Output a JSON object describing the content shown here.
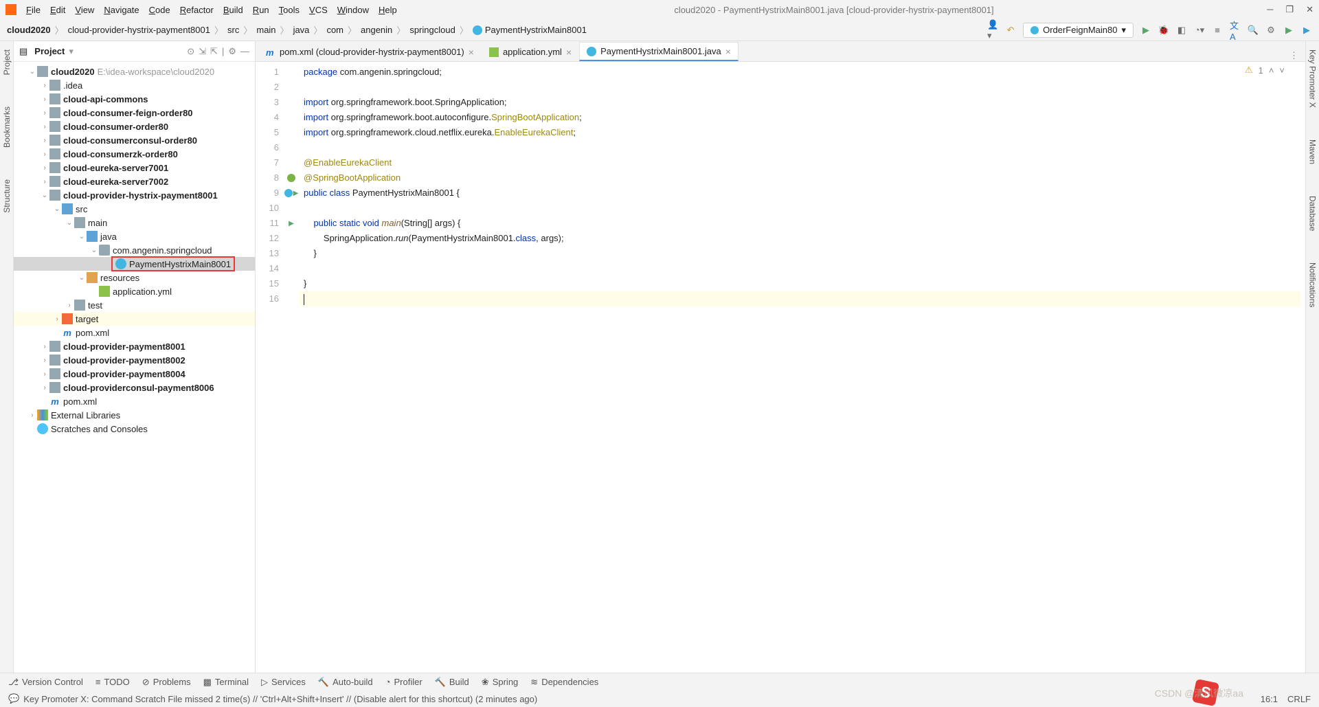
{
  "title_bar": {
    "menus": [
      "File",
      "Edit",
      "View",
      "Navigate",
      "Code",
      "Refactor",
      "Build",
      "Run",
      "Tools",
      "VCS",
      "Window",
      "Help"
    ],
    "window_title": "cloud2020 - PaymentHystrixMain8001.java [cloud-provider-hystrix-payment8001]"
  },
  "breadcrumb": [
    "cloud2020",
    "cloud-provider-hystrix-payment8001",
    "src",
    "main",
    "java",
    "com",
    "angenin",
    "springcloud",
    "PaymentHystrixMain8001"
  ],
  "run_config": "OrderFeignMain80",
  "panel": {
    "title": "Project"
  },
  "tree": {
    "root": {
      "label": "cloud2020",
      "hint": "E:\\idea-workspace\\cloud2020"
    },
    "nodes": [
      {
        "l": ".idea",
        "d": 0,
        "t": "folder",
        "a": ">"
      },
      {
        "l": "cloud-api-commons",
        "d": 0,
        "t": "folder",
        "a": ">",
        "b": true
      },
      {
        "l": "cloud-consumer-feign-order80",
        "d": 0,
        "t": "folder",
        "a": ">",
        "b": true
      },
      {
        "l": "cloud-consumer-order80",
        "d": 0,
        "t": "folder",
        "a": ">",
        "b": true
      },
      {
        "l": "cloud-consumerconsul-order80",
        "d": 0,
        "t": "folder",
        "a": ">",
        "b": true
      },
      {
        "l": "cloud-consumerzk-order80",
        "d": 0,
        "t": "folder",
        "a": ">",
        "b": true
      },
      {
        "l": "cloud-eureka-server7001",
        "d": 0,
        "t": "folder",
        "a": ">",
        "b": true
      },
      {
        "l": "cloud-eureka-server7002",
        "d": 0,
        "t": "folder",
        "a": ">",
        "b": true
      },
      {
        "l": "cloud-provider-hystrix-payment8001",
        "d": 0,
        "t": "folder",
        "a": "v",
        "b": true
      },
      {
        "l": "src",
        "d": 1,
        "t": "folder src",
        "a": "v"
      },
      {
        "l": "main",
        "d": 2,
        "t": "folder",
        "a": "v"
      },
      {
        "l": "java",
        "d": 3,
        "t": "folder src",
        "a": "v"
      },
      {
        "l": "com.angenin.springcloud",
        "d": 4,
        "t": "pkg",
        "a": "v"
      },
      {
        "l": "PaymentHystrixMain8001",
        "d": 5,
        "t": "class",
        "a": "",
        "selected": true,
        "redbox": true
      },
      {
        "l": "resources",
        "d": 3,
        "t": "folder res",
        "a": "v"
      },
      {
        "l": "application.yml",
        "d": 4,
        "t": "yml",
        "a": ""
      },
      {
        "l": "test",
        "d": 2,
        "t": "folder",
        "a": ">"
      },
      {
        "l": "target",
        "d": 1,
        "t": "folder target",
        "a": ">",
        "hl": true
      },
      {
        "l": "pom.xml",
        "d": 1,
        "t": "pom",
        "a": ""
      },
      {
        "l": "cloud-provider-payment8001",
        "d": 0,
        "t": "folder",
        "a": ">",
        "b": true
      },
      {
        "l": "cloud-provider-payment8002",
        "d": 0,
        "t": "folder",
        "a": ">",
        "b": true
      },
      {
        "l": "cloud-provider-payment8004",
        "d": 0,
        "t": "folder",
        "a": ">",
        "b": true
      },
      {
        "l": "cloud-providerconsul-payment8006",
        "d": 0,
        "t": "folder",
        "a": ">",
        "b": true
      },
      {
        "l": "pom.xml",
        "d": 0,
        "t": "pom",
        "a": ""
      }
    ],
    "extras": [
      {
        "l": "External Libraries",
        "t": "lib",
        "a": ">"
      },
      {
        "l": "Scratches and Consoles",
        "t": "scratch",
        "a": ""
      }
    ]
  },
  "tabs": [
    {
      "label": "pom.xml (cloud-provider-hystrix-payment8001)",
      "icon": "pom",
      "active": false
    },
    {
      "label": "application.yml",
      "icon": "yml",
      "active": false
    },
    {
      "label": "PaymentHystrixMain8001.java",
      "icon": "class",
      "active": true
    }
  ],
  "editor": {
    "warn_count": "1",
    "lines": [
      {
        "n": 1,
        "html": "<span class='k'>package</span> com.angenin.springcloud;"
      },
      {
        "n": 2,
        "html": ""
      },
      {
        "n": 3,
        "html": "<span class='k'>import</span> org.springframework.boot.SpringApplication;"
      },
      {
        "n": 4,
        "html": "<span class='k'>import</span> org.springframework.boot.autoconfigure.<span class='ann'>SpringBootApplication</span>;"
      },
      {
        "n": 5,
        "html": "<span class='k'>import</span> org.springframework.cloud.netflix.eureka.<span class='ann'>EnableEurekaClient</span>;"
      },
      {
        "n": 6,
        "html": ""
      },
      {
        "n": 7,
        "html": "<span class='ann'>@EnableEurekaClient</span>"
      },
      {
        "n": 8,
        "html": "<span class='ann'>@SpringBootApplication</span>",
        "g": "circ"
      },
      {
        "n": 9,
        "html": "<span class='k'>public</span> <span class='k'>class</span> PaymentHystrixMain8001 {",
        "g": "run2"
      },
      {
        "n": 10,
        "html": ""
      },
      {
        "n": 11,
        "html": "    <span class='k'>public</span> <span class='k'>static</span> <span class='k'>void</span> <span class='mth'>main</span>(String[] args) {",
        "g": "run"
      },
      {
        "n": 12,
        "html": "        SpringApplication.<span class='id'>run</span>(PaymentHystrixMain8001.<span class='k'>class</span>, args);"
      },
      {
        "n": 13,
        "html": "    }"
      },
      {
        "n": 14,
        "html": ""
      },
      {
        "n": 15,
        "html": "}"
      },
      {
        "n": 16,
        "html": "",
        "caret": true
      }
    ]
  },
  "rail_left": [
    "Project",
    "Bookmarks",
    "Structure"
  ],
  "rail_right": [
    "Key Promoter X",
    "Maven",
    "Database",
    "Notifications"
  ],
  "bottom": [
    "Version Control",
    "TODO",
    "Problems",
    "Terminal",
    "Services",
    "Auto-build",
    "Profiler",
    "Build",
    "Spring",
    "Dependencies"
  ],
  "status": {
    "msg": "Key Promoter X: Command Scratch File missed 2 time(s) // 'Ctrl+Alt+Shift+Insert' // (Disable alert for this shortcut) (2 minutes ago)",
    "pos": "16:1",
    "enc": "CRLF"
  },
  "watermark": "CSDN @清风微凉aa"
}
